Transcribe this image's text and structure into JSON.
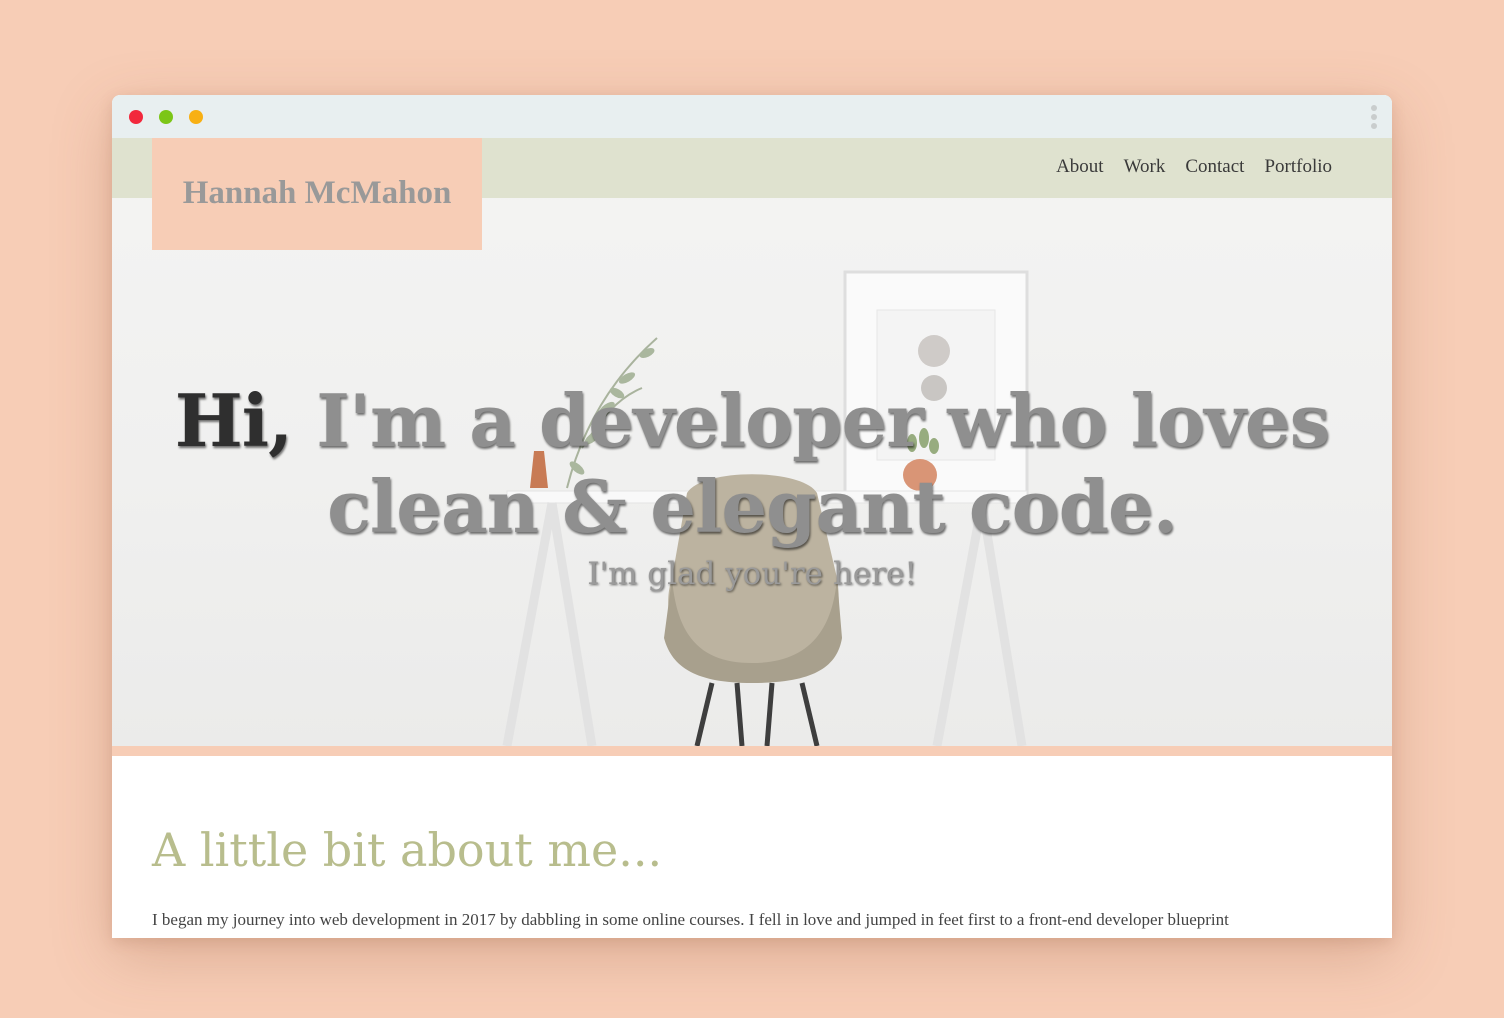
{
  "window": {
    "controls": [
      "close",
      "minimize",
      "maximize"
    ],
    "menu_icon": "kebab-menu-icon"
  },
  "site": {
    "logo": "Hannah McMahon",
    "nav": [
      "About",
      "Work",
      "Contact",
      "Portfolio"
    ]
  },
  "hero": {
    "greeting": "Hi,",
    "headline_rest": " I'm a developer who loves clean & elegant code.",
    "subheadline": "I'm glad you're here!"
  },
  "about": {
    "title": "A little bit about me...",
    "text": "I began my journey into web development in 2017 by dabbling in some online courses. I fell in love and jumped in feet first to a front-end developer blueprint"
  },
  "colors": {
    "background": "#f7cdb6",
    "navbar": "#dfe2cf",
    "logo_box": "#f7cdb6",
    "about_title": "#b8bd8d",
    "close": "#f2283c",
    "minimize": "#7cc617",
    "maximize": "#f8b013"
  }
}
